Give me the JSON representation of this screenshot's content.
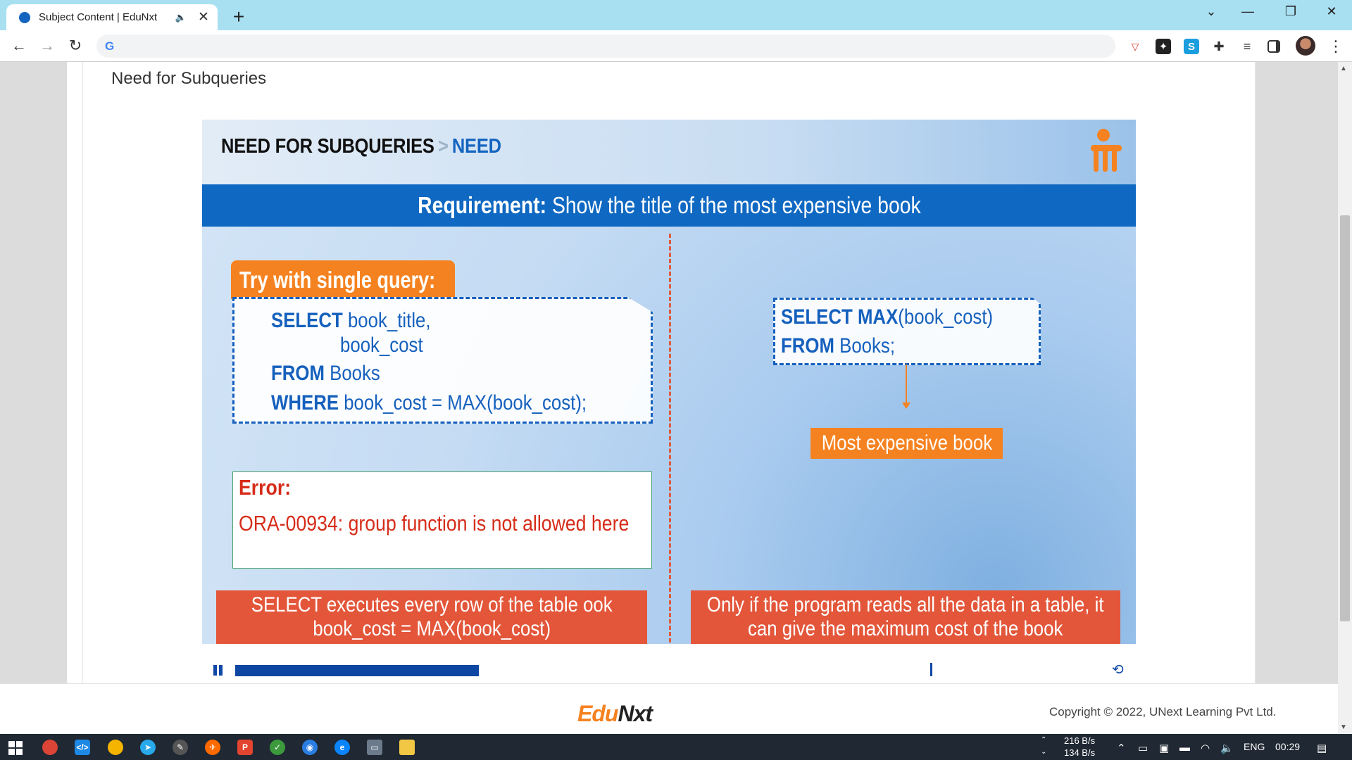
{
  "browser": {
    "tab_title": "Subject Content | EduNxt",
    "tab_close": "✕",
    "tab_audio": "🔈",
    "new_tab": "+",
    "window_controls": {
      "dropdown": "⌄",
      "minimize": "—",
      "restore": "❐",
      "close": "✕"
    },
    "nav": {
      "back": "←",
      "forward": "→",
      "reload": "↻"
    },
    "omnibox_icon": "G",
    "menu": "⋮"
  },
  "page": {
    "heading": "Need for Subqueries"
  },
  "slide": {
    "breadcrumb_main": "NEED FOR SUBQUERIES",
    "breadcrumb_sep": ">",
    "breadcrumb_sub": "NEED",
    "requirement_label": "Requirement:",
    "requirement_text": " Show the title of the most expensive book",
    "try_label": "Try with single query:",
    "query": {
      "l1_kw": "SELECT",
      "l1_rest": " book_title,",
      "l2": "book_cost",
      "l3_kw": "FROM",
      "l3_rest": " Books",
      "l4_kw": "WHERE",
      "l4_rest": " book_cost = MAX(book_cost);"
    },
    "error_title": "Error:",
    "error_message": "ORA-00934: group function is not allowed here",
    "right_query": {
      "l1_kw": "SELECT MAX",
      "l1_rest": "(book_cost)",
      "l2_kw": "FROM",
      "l2_rest": " Books;"
    },
    "result_label": "Most expensive book",
    "note_left_1": "SELECT executes every row of the table ook",
    "note_left_2": "book_cost = MAX(book_cost)",
    "note_right_1": "Only if the program reads all the data in a table, it",
    "note_right_2": "can give the maximum cost of the book"
  },
  "player": {
    "progress_fraction": 0.32,
    "replay_icon": "⟲"
  },
  "footer": {
    "logo_a": "Edu",
    "logo_b": "Nxt",
    "copyright": "Copyright © 2022, UNext Learning Pvt Ltd."
  },
  "taskbar": {
    "net_up": "216 B/s",
    "net_down": "134 B/s",
    "language": "ENG",
    "time": "00:29"
  },
  "colors": {
    "slide_blue": "#0f68c2",
    "accent_orange": "#f58220",
    "error_red": "#d62c1a",
    "note_red": "#e3563a"
  }
}
